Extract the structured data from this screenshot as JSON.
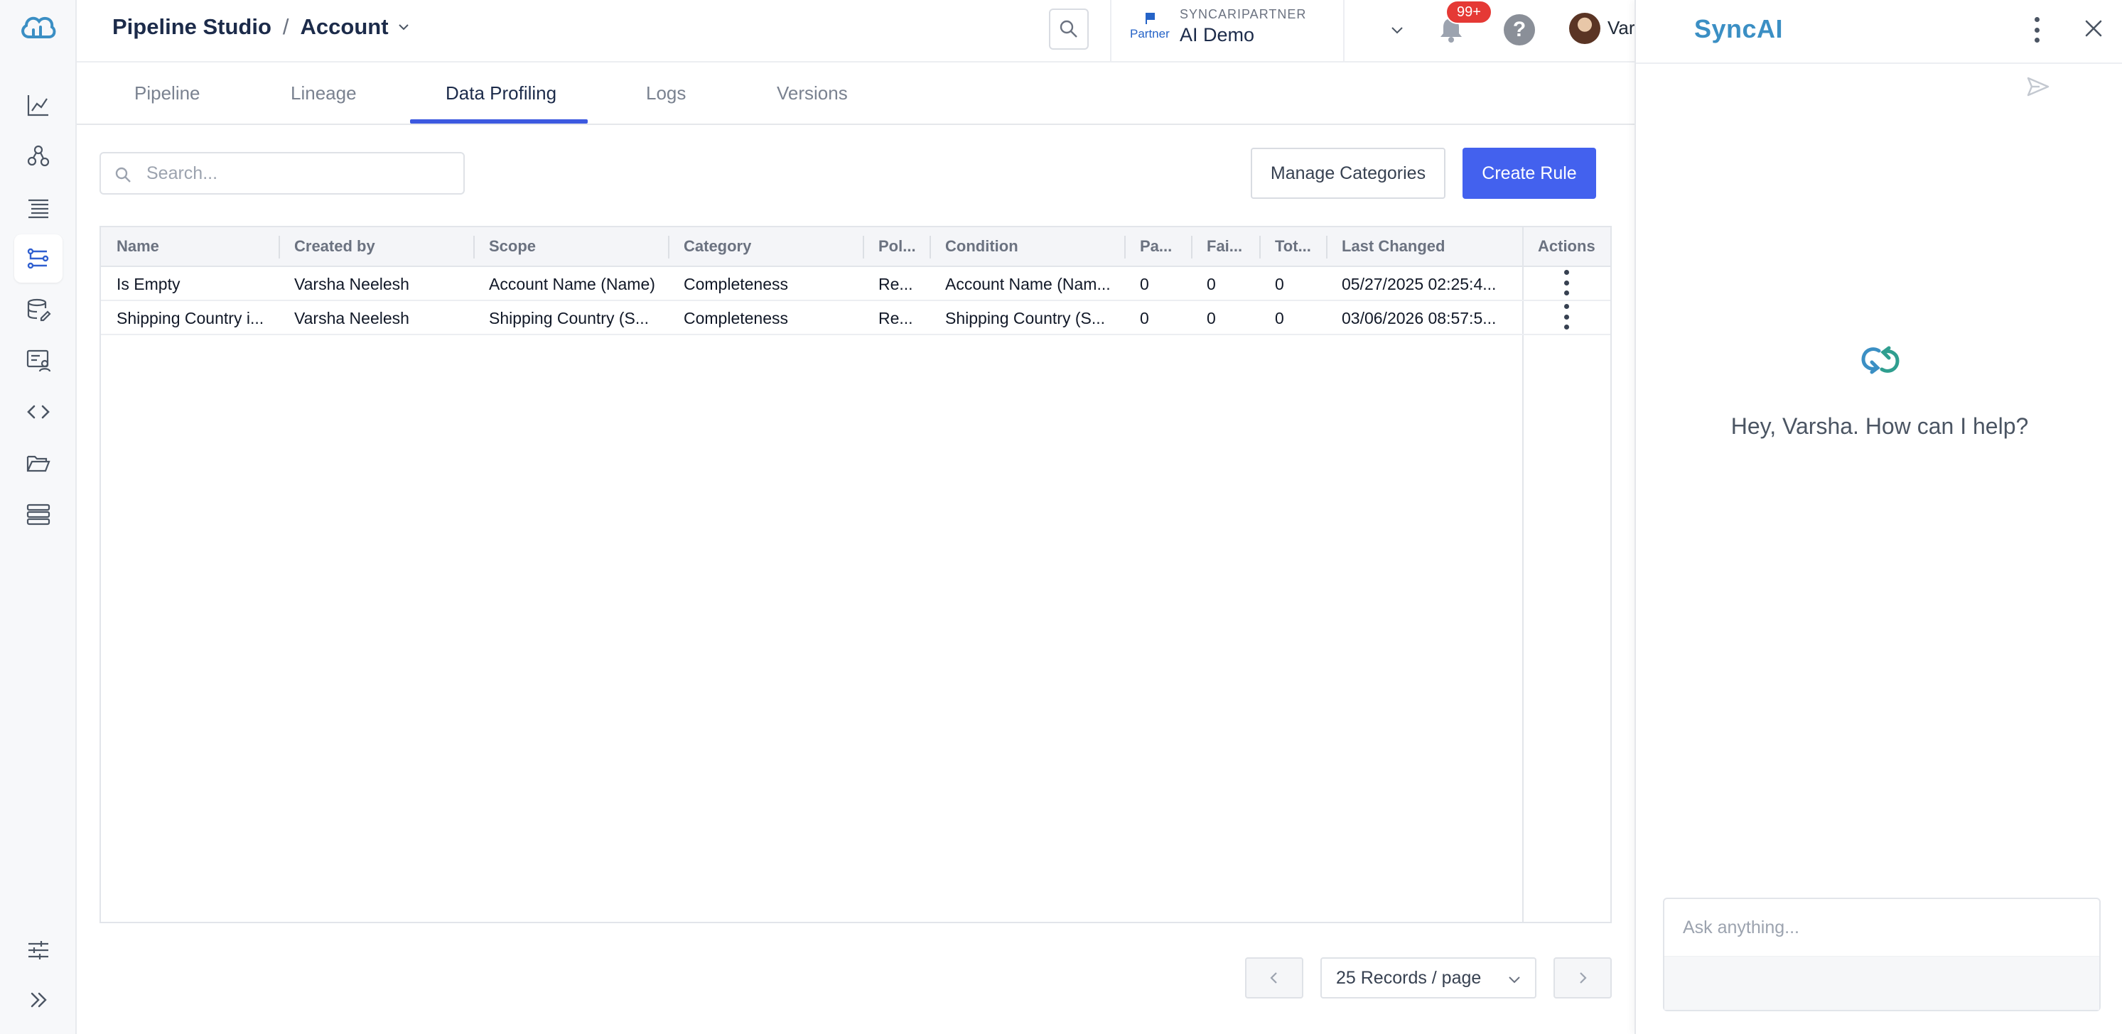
{
  "colors": {
    "primary": "#4361ee",
    "tab_accent": "#3c59e0",
    "ai_brand": "#3b8fc4",
    "badge": "#e53935"
  },
  "header": {
    "breadcrumb_root": "Pipeline Studio",
    "breadcrumb_sep": "/",
    "breadcrumb_current": "Account",
    "partner_label": "Partner",
    "org_caption": "SYNCARIPARTNER",
    "org_name": "AI Demo",
    "notification_badge": "99+",
    "help_label": "?",
    "user_name": "Varsha"
  },
  "tabs": [
    {
      "label": "Pipeline"
    },
    {
      "label": "Lineage"
    },
    {
      "label": "Data Profiling"
    },
    {
      "label": "Logs"
    },
    {
      "label": "Versions"
    }
  ],
  "active_tab": "Data Profiling",
  "toolbar": {
    "search_placeholder": "Search...",
    "manage_label": "Manage Categories",
    "create_label": "Create Rule"
  },
  "table": {
    "columns": [
      "Name",
      "Created by",
      "Scope",
      "Category",
      "Pol...",
      "Condition",
      "Pa...",
      "Fai...",
      "Tot...",
      "Last Changed",
      "Actions"
    ],
    "rows": [
      [
        "Is Empty",
        "Varsha Neelesh",
        "Account Name (Name)",
        "Completeness",
        "Re...",
        "Account Name (Nam...",
        "0",
        "0",
        "0",
        "05/27/2025 02:25:4..."
      ],
      [
        "Shipping Country i...",
        "Varsha Neelesh",
        "Shipping Country (S...",
        "Completeness",
        "Re...",
        "Shipping Country (S...",
        "0",
        "0",
        "0",
        "03/06/2026 08:57:5..."
      ]
    ]
  },
  "pagination": {
    "page_size": "25 Records / page"
  },
  "ai_panel": {
    "title": "SyncAI",
    "greeting": "Hey, Varsha. How can I help?",
    "input_placeholder": "Ask anything..."
  },
  "sidebar": {
    "items": [
      {
        "icon": "chart-icon"
      },
      {
        "icon": "nodes-icon"
      },
      {
        "icon": "list-icon"
      },
      {
        "icon": "pipeline-icon",
        "active": true
      },
      {
        "icon": "database-edit-icon"
      },
      {
        "icon": "monitor-user-icon"
      },
      {
        "icon": "code-icon"
      },
      {
        "icon": "folder-icon"
      },
      {
        "icon": "stack-icon"
      }
    ]
  }
}
